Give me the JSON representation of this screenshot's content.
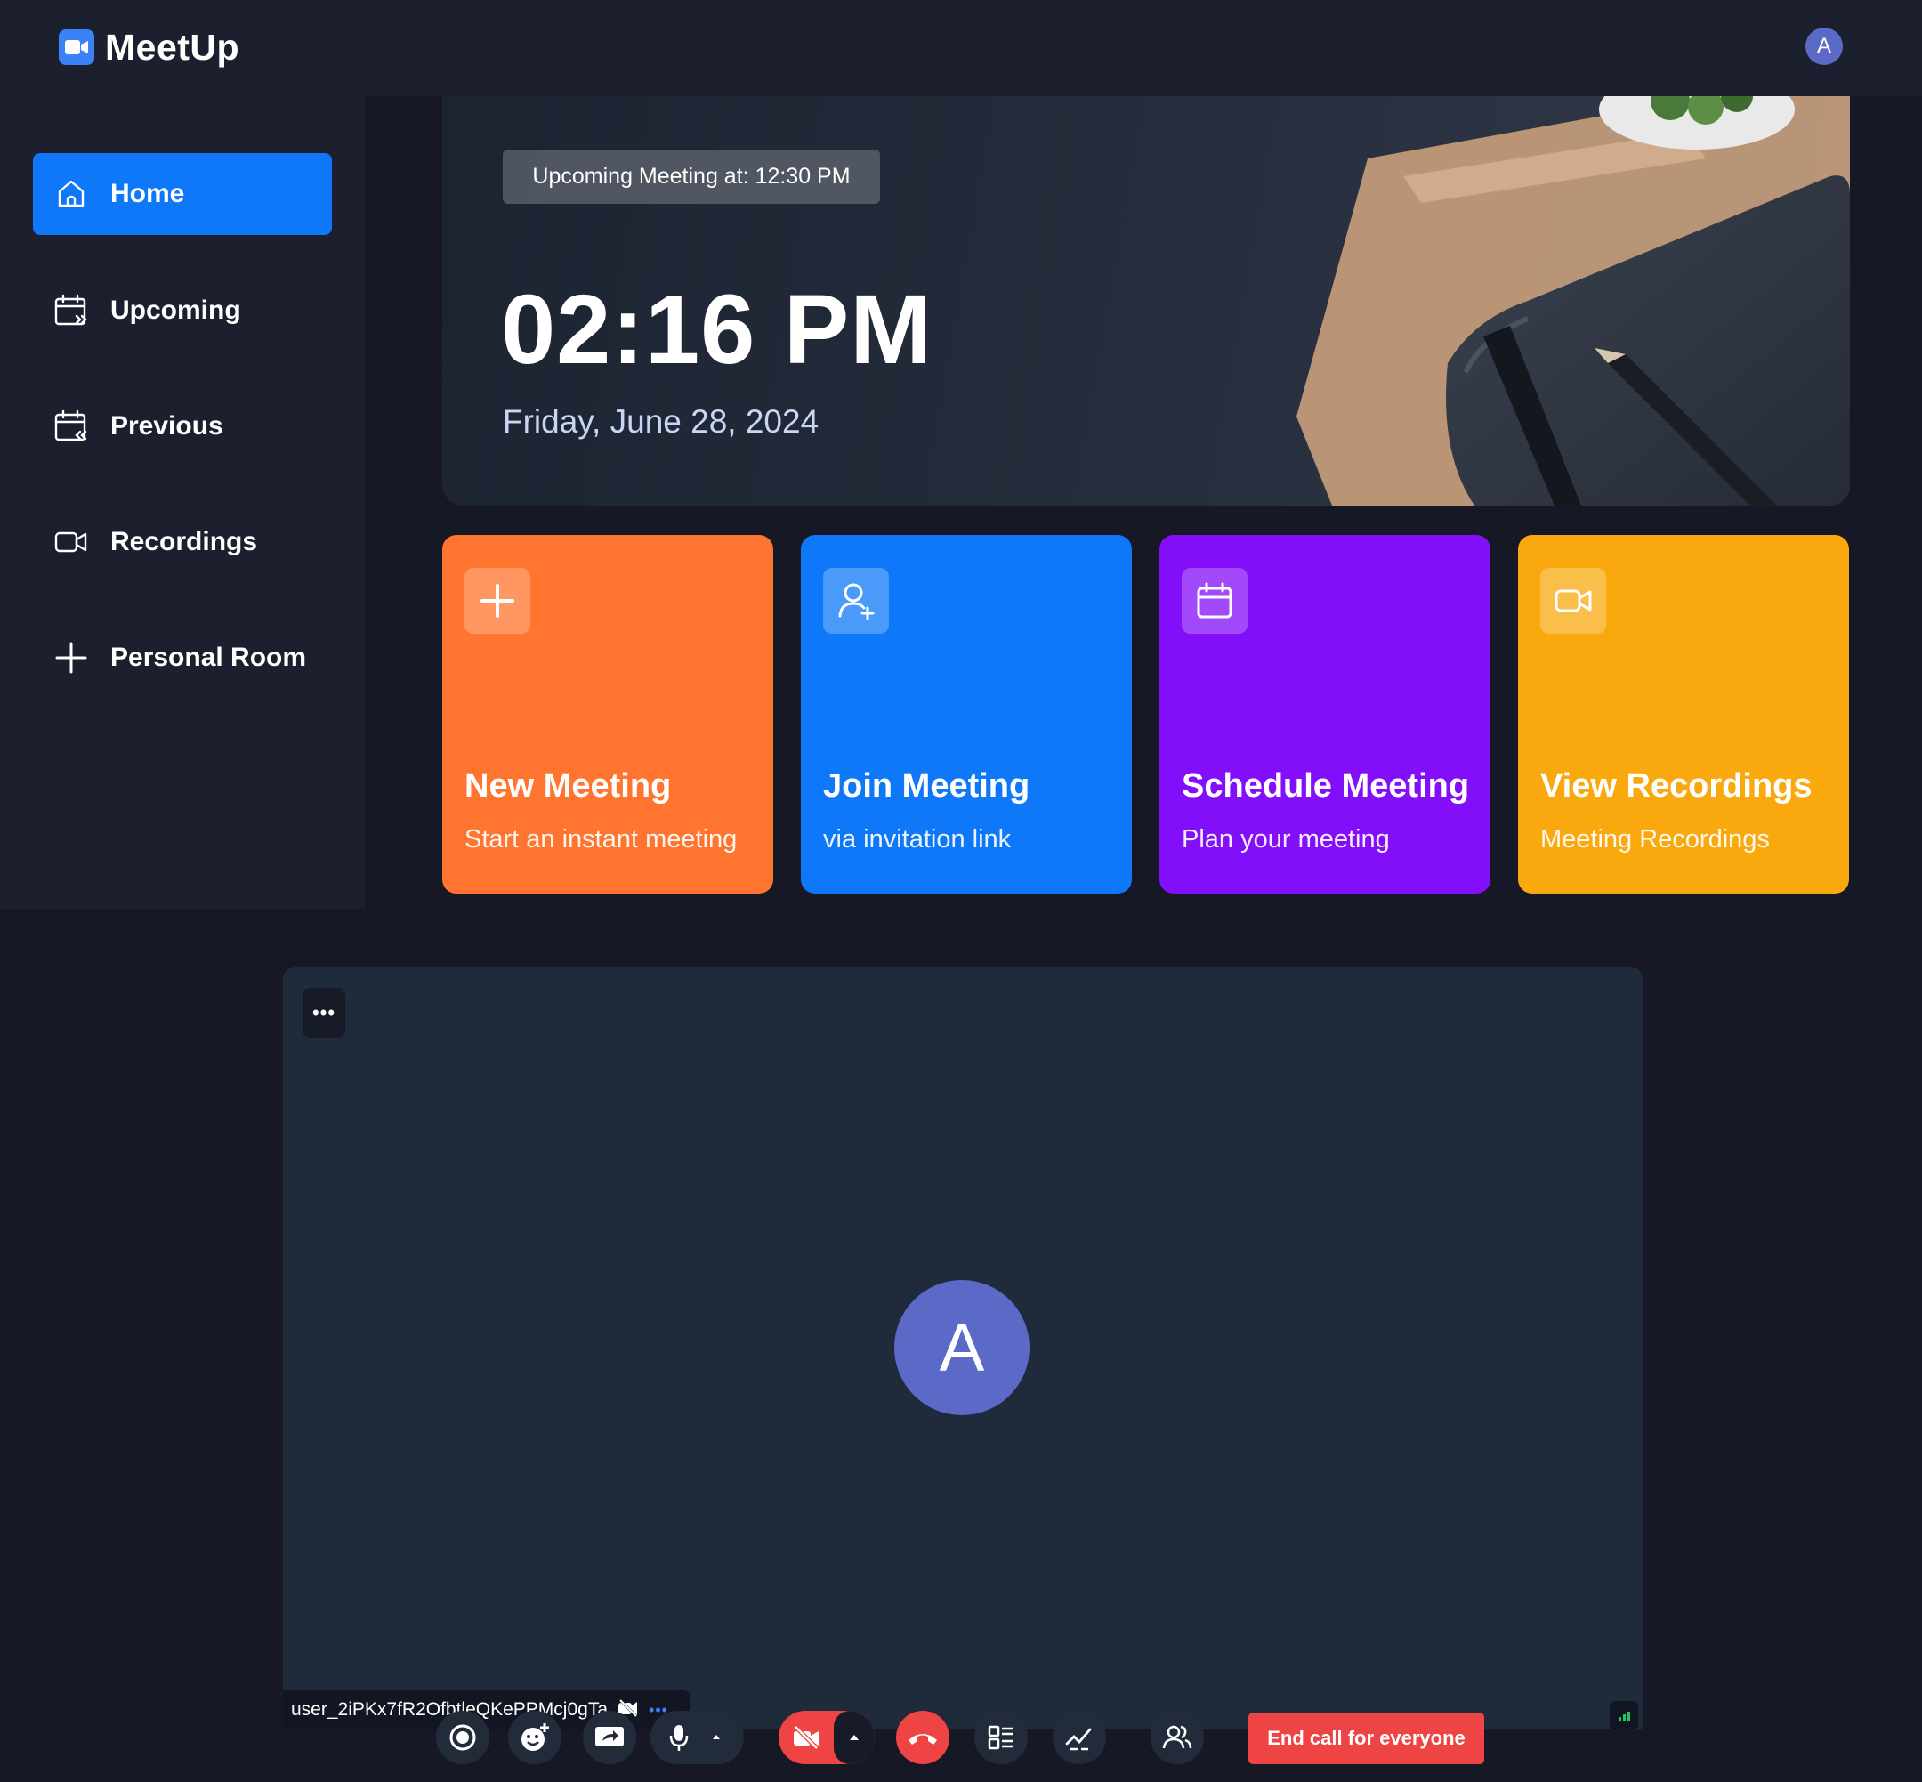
{
  "app": {
    "name": "MeetUp",
    "user_initial": "A"
  },
  "sidebar": {
    "items": [
      {
        "label": "Home",
        "icon": "home-icon",
        "active": true
      },
      {
        "label": "Upcoming",
        "icon": "calendar-upcoming-icon",
        "active": false
      },
      {
        "label": "Previous",
        "icon": "calendar-previous-icon",
        "active": false
      },
      {
        "label": "Recordings",
        "icon": "video-icon",
        "active": false
      },
      {
        "label": "Personal Room",
        "icon": "plus-icon",
        "active": false
      }
    ]
  },
  "hero": {
    "upcoming_label": "Upcoming Meeting at: 12:30 PM",
    "time": "02:16 PM",
    "date": "Friday, June 28, 2024"
  },
  "cards": [
    {
      "title": "New Meeting",
      "subtitle": "Start an instant meeting",
      "icon": "plus-icon",
      "color": "#ff742e"
    },
    {
      "title": "Join Meeting",
      "subtitle": "via invitation link",
      "icon": "user-add-icon",
      "color": "#0e78f9"
    },
    {
      "title": "Schedule Meeting",
      "subtitle": "Plan your meeting",
      "icon": "calendar-icon",
      "color": "#830ef9"
    },
    {
      "title": "View Recordings",
      "subtitle": "Meeting Recordings",
      "icon": "video-icon",
      "color": "#f9a90e"
    }
  ],
  "call": {
    "more_label": "•••",
    "participant_initial": "A",
    "participant_name": "user_2iPKx7fR2OfbtleQKePPMcj0gTa",
    "end_all_label": "End call for everyone"
  },
  "colors": {
    "background": "#161925",
    "panel": "#1c1f2e",
    "accent_blue": "#0e78f9",
    "danger": "#ef4444",
    "avatar": "#5b6ac6"
  }
}
